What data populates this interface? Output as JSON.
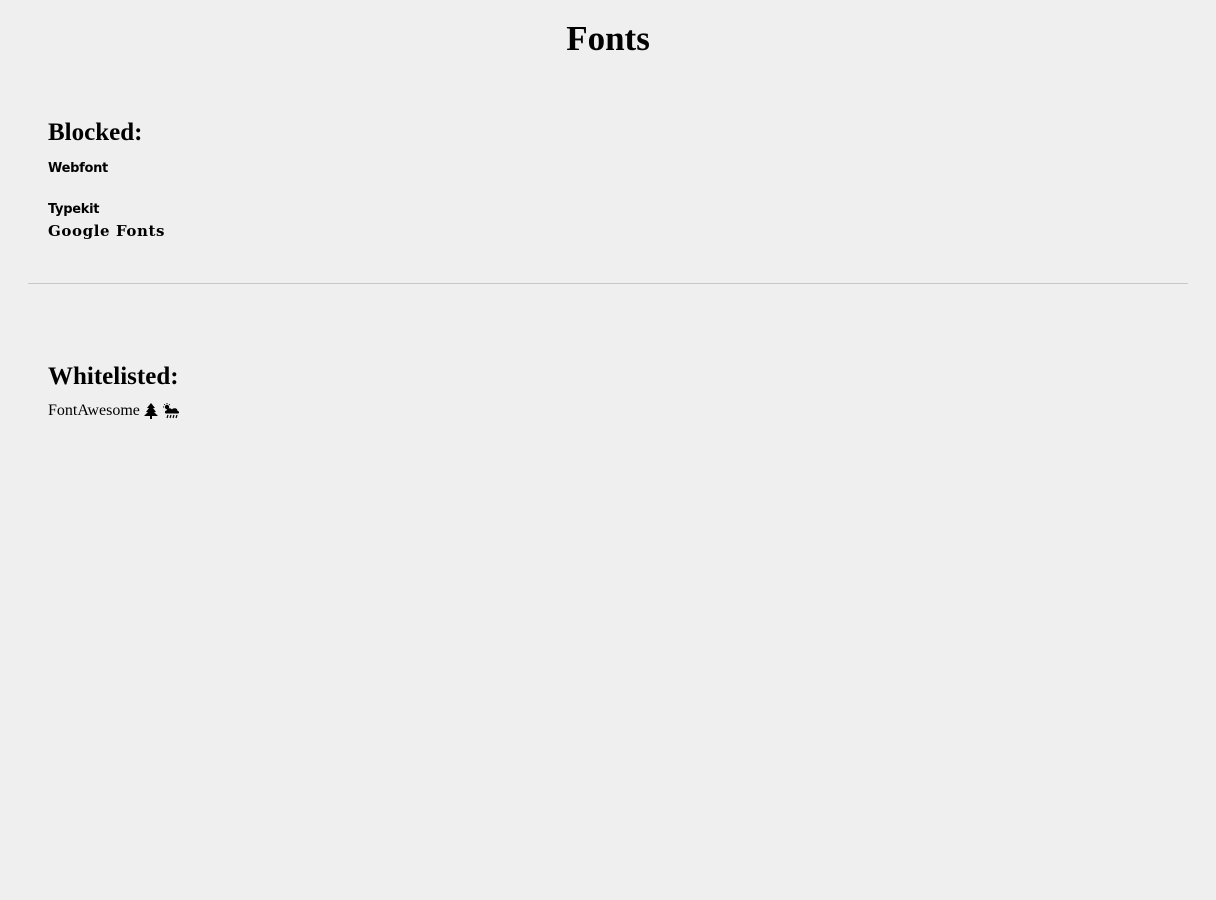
{
  "page": {
    "title": "Fonts"
  },
  "blocked": {
    "heading": "Blocked:",
    "items": [
      "Webfont",
      "Typekit",
      "Google Fonts"
    ]
  },
  "whitelisted": {
    "heading": "Whitelisted:",
    "fontawesome_label": "FontAwesome",
    "icons": [
      "tree-icon",
      "cloud-rain-sun-icon"
    ]
  }
}
